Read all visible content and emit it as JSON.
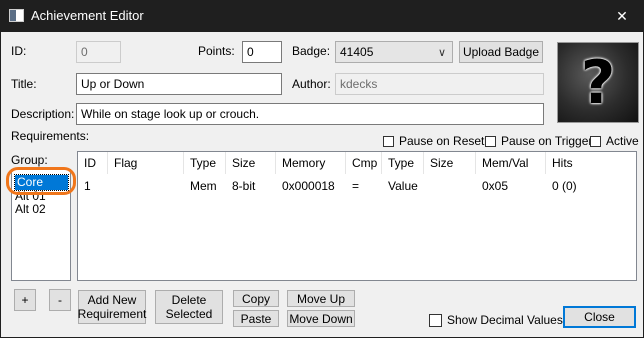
{
  "window": {
    "title": "Achievement Editor",
    "close_glyph": "✕"
  },
  "fields": {
    "id_label": "ID:",
    "id_value": "0",
    "points_label": "Points:",
    "points_value": "0",
    "badge_label": "Badge:",
    "badge_value": "41405",
    "upload_badge_label": "Upload Badge",
    "title_label": "Title:",
    "title_value": "Up or Down",
    "author_label": "Author:",
    "author_value": "kdecks",
    "description_label": "Description:",
    "description_value": "While on stage look up or crouch.",
    "badge_image_glyph": "?"
  },
  "requirements": {
    "label": "Requirements:",
    "pause_on_reset": "Pause on Reset",
    "pause_on_trigger": "Pause on Trigger",
    "active": "Active",
    "group_label": "Group:",
    "groups": [
      "Core",
      "Alt 01",
      "Alt 02"
    ],
    "selected_group": "Core",
    "columns": [
      "ID",
      "Flag",
      "Type",
      "Size",
      "Memory",
      "Cmp",
      "Type",
      "Size",
      "Mem/Val",
      "Hits"
    ],
    "rows": [
      [
        "1",
        "",
        "Mem",
        "8-bit",
        "0x000018",
        "=",
        "Value",
        "",
        "0x05",
        "0 (0)"
      ]
    ]
  },
  "buttons": {
    "add_group": "+",
    "remove_group": "-",
    "add_new_requirement": "Add New Requirement",
    "delete_selected": "Delete Selected",
    "copy": "Copy",
    "paste": "Paste",
    "move_up": "Move Up",
    "move_down": "Move Down",
    "show_decimal_values": "Show Decimal Values",
    "close": "Close"
  },
  "colors": {
    "highlight_ring": "#f0761b",
    "selection": "#0078d7"
  }
}
